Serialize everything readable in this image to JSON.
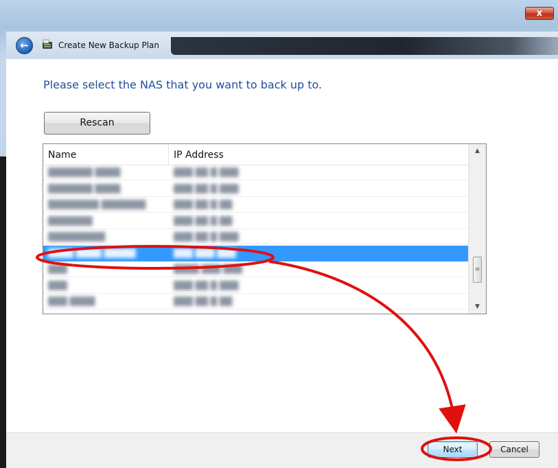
{
  "window": {
    "title": "Create New Backup Plan",
    "close_glyph": "x"
  },
  "nav": {
    "back_glyph": "←"
  },
  "content": {
    "instruction": "Please select the NAS that you want to back up to.",
    "rescan_label": "Rescan"
  },
  "list": {
    "columns": [
      "Name",
      "IP Address"
    ],
    "selected_index": 5,
    "rows": [
      {
        "name": "███████ ████",
        "ip": "███ ██ █ ███"
      },
      {
        "name": "███████ ████",
        "ip": "███ ██ █ ███"
      },
      {
        "name": "████████ ███████",
        "ip": "███ ██ █ ██"
      },
      {
        "name": "███████",
        "ip": "███ ██ █ ██"
      },
      {
        "name": "█████████",
        "ip": "███ ██ █ ███"
      },
      {
        "name": "████ ████ █████",
        "ip": "███ ███ ███"
      },
      {
        "name": "███",
        "ip": "████ ███ ███"
      },
      {
        "name": "███",
        "ip": "███ ██ █ ███"
      },
      {
        "name": "███ ████",
        "ip": "███ ██ █ ██"
      }
    ]
  },
  "scrollbar": {
    "up_glyph": "▲",
    "down_glyph": "▼",
    "thumb_glyph": "≡"
  },
  "footer": {
    "next_label": "Next",
    "cancel_label": "Cancel"
  },
  "colors": {
    "accent_text": "#1e4e9b",
    "selection": "#3399ff",
    "annotation": "#e01010"
  }
}
